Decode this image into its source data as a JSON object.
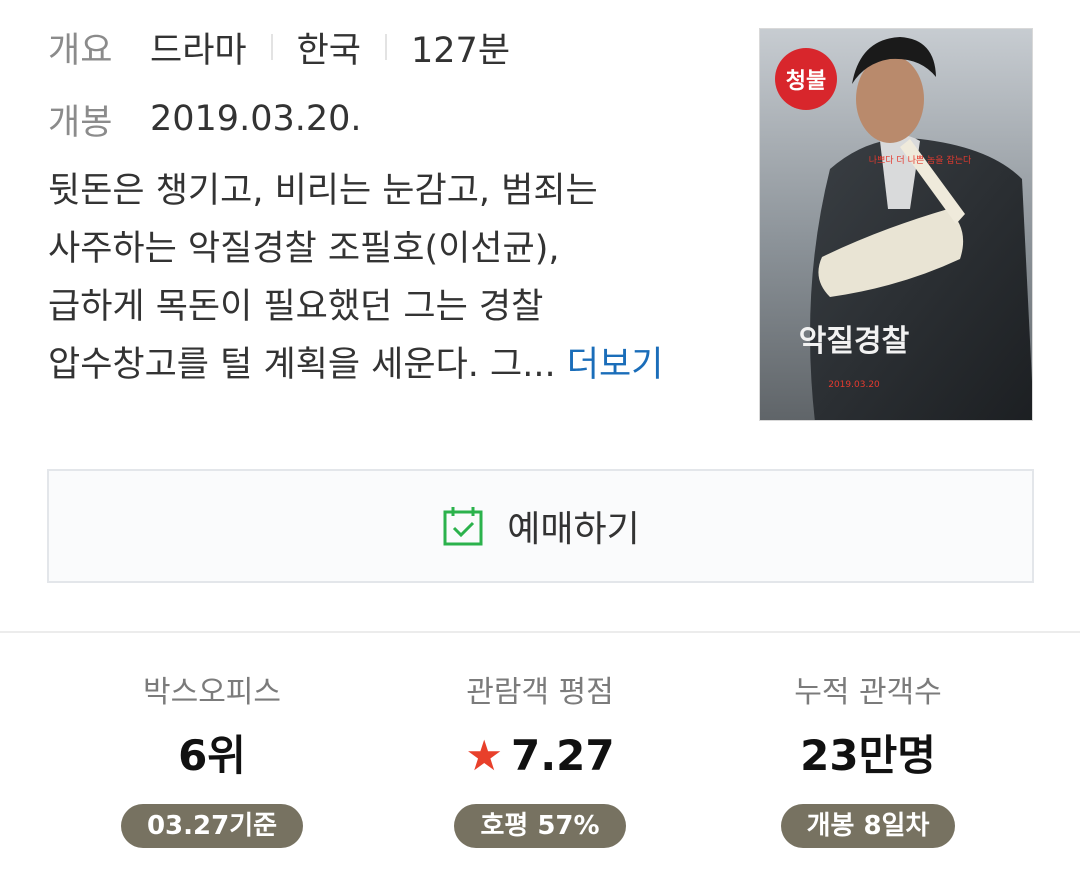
{
  "overview": {
    "label": "개요",
    "genre": "드라마",
    "country": "한국",
    "runtime": "127분"
  },
  "release": {
    "label": "개봉",
    "date": "2019.03.20."
  },
  "synopsis": {
    "lines": [
      "뒷돈은 챙기고, 비리는 눈감고, 범죄는",
      "사주하는 악질경찰 조필호(이선균),",
      "급하게 목돈이 필요했던 그는 경찰",
      "압수창고를 털 계획을 세운다. 그..."
    ],
    "more_label": "더보기"
  },
  "poster": {
    "rating_badge": "청불",
    "title": "악질경찰",
    "tagline": "나쁘다 더 나쁜 놈을 잡는다",
    "date_text": "2019.03.20",
    "badge_color": "#d8262c"
  },
  "reserve": {
    "label": "예매하기",
    "icon": "calendar-check-icon",
    "icon_color": "#2bb24c"
  },
  "stats": [
    {
      "title": "박스오피스",
      "value": "6위",
      "badge": "03.27기준"
    },
    {
      "title": "관람객 평점",
      "value": "7.27",
      "badge": "호평 57%",
      "icon": "star-icon",
      "icon_color": "#e8402b"
    },
    {
      "title": "누적 관객수",
      "value": "23만명",
      "badge": "개봉 8일차"
    }
  ]
}
